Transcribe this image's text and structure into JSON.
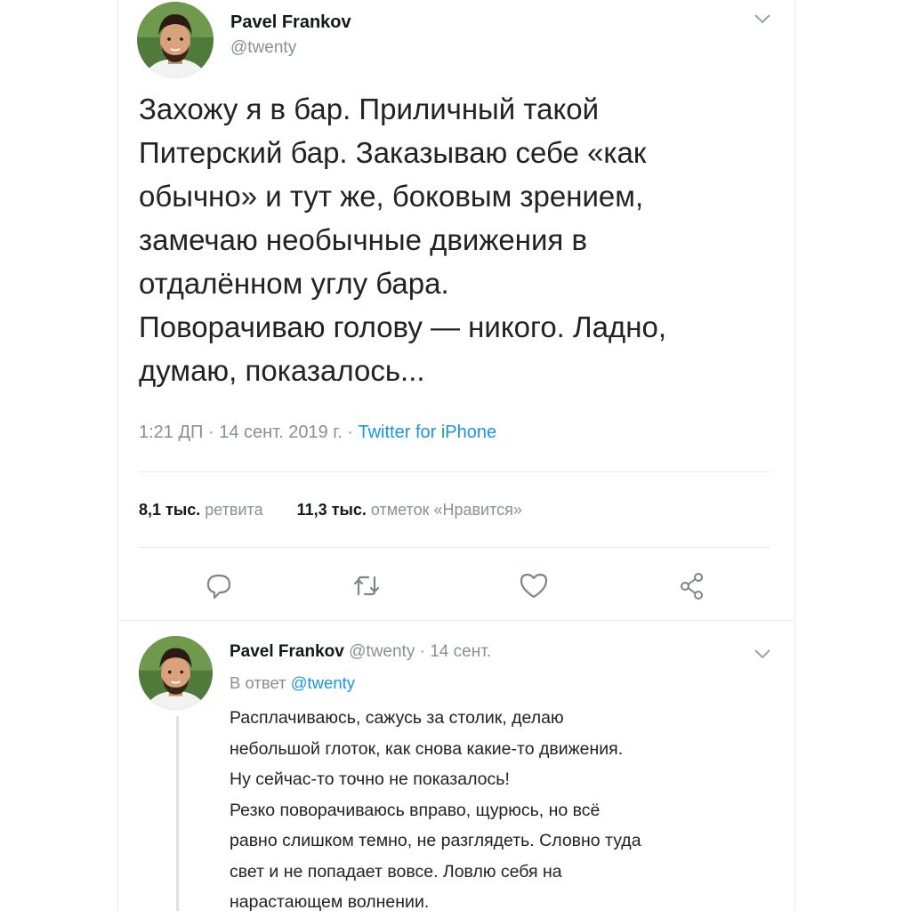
{
  "main_tweet": {
    "author": {
      "name": "Pavel Frankov",
      "handle": "@twenty"
    },
    "text_lines": [
      "Захожу я в бар. Приличный такой",
      "Питерский бар. Заказываю себе «как",
      "обычно» и тут же, боковым зрением,",
      "замечаю необычные движения в",
      "отдалённом углу бара.",
      "Поворачиваю голову — никого. Ладно,",
      "думаю, показалось..."
    ],
    "time": "1:21 ДП",
    "date": "14 сент. 2019 г.",
    "separator": "·",
    "source": "Twitter for iPhone",
    "stats": {
      "retweets_count": "8,1 тыс.",
      "retweets_label": "ретвита",
      "likes_count": "11,3 тыс.",
      "likes_label": "отметок «Нравится»"
    },
    "actions": {
      "reply_icon": "speech-bubble-icon",
      "retweet_icon": "retweet-icon",
      "like_icon": "heart-icon",
      "share_icon": "share-icon"
    }
  },
  "reply_tweet": {
    "author": {
      "name": "Pavel Frankov",
      "handle": "@twenty"
    },
    "separator": "·",
    "date": "14 сент.",
    "reply_to_prefix": "В ответ",
    "reply_to_handle": "@twenty",
    "text_lines": [
      "Расплачиваюсь, сажусь за столик, делаю",
      "небольшой глоток, как снова какие-то движения.",
      "Ну сейчас-то точно не показалось!",
      "Резко поворачиваюсь вправо, щурюсь, но всё",
      "равно слишком темно, не разглядеть. Словно туда",
      "свет и не попадает вовсе. Ловлю себя на",
      "нарастающем волнении."
    ]
  },
  "colors": {
    "link": "#1b95e0",
    "muted": "#8a8f94",
    "text": "#14171a"
  }
}
